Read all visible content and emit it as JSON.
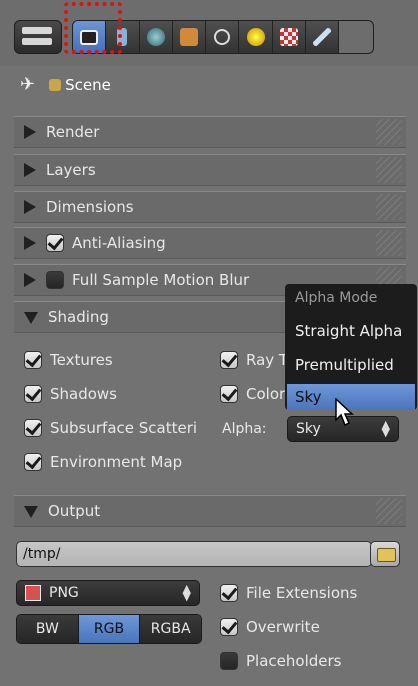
{
  "context": {
    "label": "Scene"
  },
  "panels": {
    "render": "Render",
    "layers": "Layers",
    "dimensions": "Dimensions",
    "anti_aliasing": "Anti-Aliasing",
    "full_sample_motion_blur": "Full Sample Motion Blur",
    "shading": "Shading",
    "output": "Output"
  },
  "shading": {
    "textures": "Textures",
    "shadows": "Shadows",
    "subsurface": "Subsurface Scatteri",
    "environment_map": "Environment Map",
    "ray_tracing": "Ray T",
    "color_management": "Color",
    "alpha_label": "Alpha:",
    "alpha_value": "Sky"
  },
  "alpha_menu": {
    "title": "Alpha Mode",
    "items": [
      "Straight Alpha",
      "Premultiplied",
      "Sky"
    ]
  },
  "output": {
    "path": "/tmp/",
    "format": "PNG",
    "color_modes": [
      "BW",
      "RGB",
      "RGBA"
    ],
    "file_extensions": "File Extensions",
    "overwrite": "Overwrite",
    "placeholders": "Placeholders"
  },
  "colors": {
    "accent": "#5a84c8",
    "highlight": "#e01010"
  }
}
